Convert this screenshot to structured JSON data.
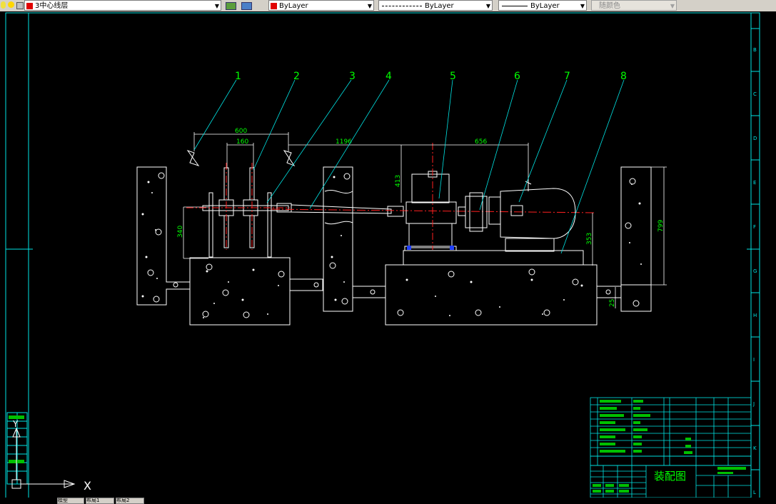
{
  "toolbar": {
    "layer_name": "3中心线层",
    "color_label": "ByLayer",
    "linetype_label": "ByLayer",
    "lineweight_label": "ByLayer",
    "plotstyle_label": "随颜色",
    "accent_color": "#e00000"
  },
  "drawing": {
    "balloons": [
      "1",
      "2",
      "3",
      "4",
      "5",
      "6",
      "7",
      "8"
    ],
    "dimensions": {
      "d600": "600",
      "d160": "160",
      "d1196": "1196",
      "d656": "656",
      "d413": "413",
      "d340": "340",
      "d353": "353",
      "d799": "799",
      "d25": "25"
    },
    "title": "装配图",
    "border_letters": [
      "B",
      "C",
      "D",
      "E",
      "F",
      "G",
      "H",
      "I",
      "J",
      "K",
      "L"
    ],
    "ucs_x": "X",
    "ucs_y": "Y"
  },
  "tabs": [
    "模型",
    "布局1",
    "布局2"
  ],
  "colors": {
    "background": "#000000",
    "geometry": "#ffffff",
    "dimension": "#00ff00",
    "leader": "#00ffff",
    "centerline": "#ff0000",
    "frame": "#00ffff"
  }
}
